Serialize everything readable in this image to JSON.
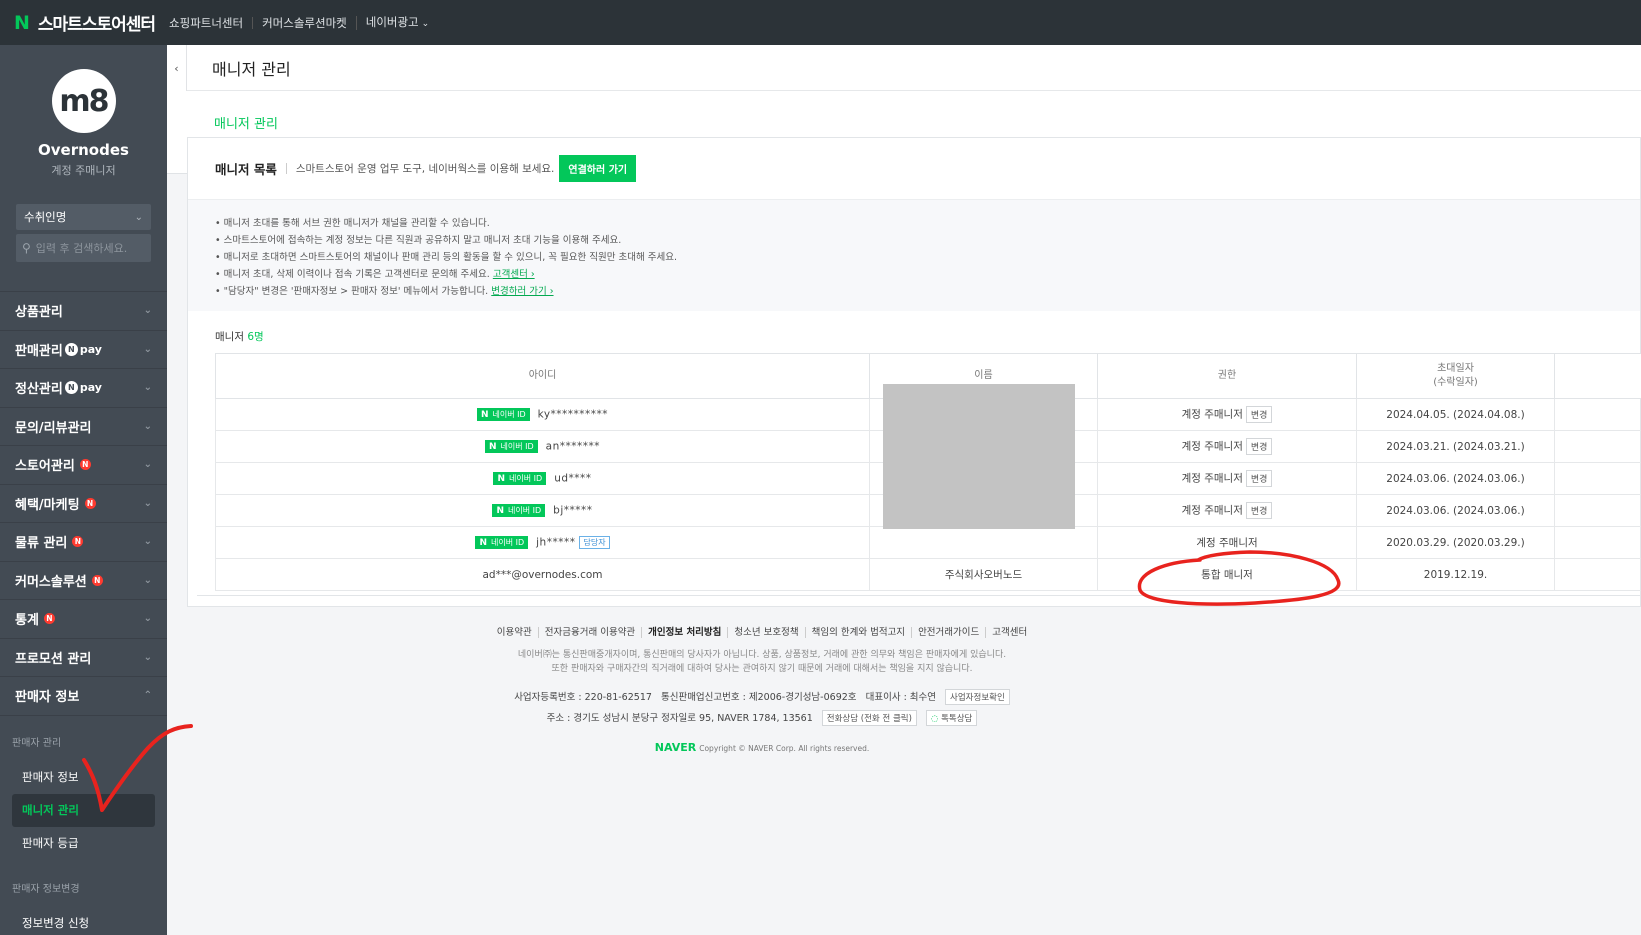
{
  "topbar": {
    "logo_letter": "N",
    "brand": "스마트스토어센터",
    "links": [
      "쇼핑파트너센터",
      "커머스솔루션마켓",
      "네이버광고"
    ]
  },
  "sidebar": {
    "avatar_text": "m8",
    "store_name": "Overnodes",
    "store_role": "계정 주매니저",
    "select_value": "수취인명",
    "search_placeholder": "입력 후 검색하세요.",
    "menu": [
      {
        "label": "상품관리"
      },
      {
        "label": "판매관리",
        "pay": "pay"
      },
      {
        "label": "정산관리",
        "pay": "pay"
      },
      {
        "label": "문의/리뷰관리"
      },
      {
        "label": "스토어관리",
        "badge": "N"
      },
      {
        "label": "혜택/마케팅",
        "badge": "N"
      },
      {
        "label": "물류 관리",
        "badge": "N"
      },
      {
        "label": "커머스솔루션",
        "badge": "N"
      },
      {
        "label": "통계",
        "badge": "N"
      },
      {
        "label": "프로모션 관리"
      },
      {
        "label": "판매자 정보"
      }
    ],
    "sub_head_1": "판매자 관리",
    "sub_items": [
      "판매자 정보",
      "매니저 관리",
      "판매자 등급"
    ],
    "sub_head_2": "판매자 정보변경",
    "sub_item_last": "정보변경 신청"
  },
  "page": {
    "title": "매니저 관리",
    "tab": "매니저 관리"
  },
  "card": {
    "title": "매니저 목록",
    "desc": "스마트스토어 운영 업무 도구, 네이버웍스를 이용해 보세요.",
    "connect_button": "연결하러 가기",
    "notices": [
      "• 매니저 초대를 통해 서브 권한 매니저가 채널을 관리할 수 있습니다.",
      "• 스마트스토어에 접속하는 계정 정보는 다른 직원과 공유하지 말고 매니저 초대 기능을 이용해 주세요.",
      "• 매니저로 초대하면 스마트스토어의 채널이나 판매 관리 등의 활동을 할 수 있으니, 꼭 필요한 직원만 초대해 주세요.",
      "• 매니저 초대, 삭제 이력이나 접속 기록은 고객센터로 문의해 주세요.",
      "• \"담당자\" 변경은 '판매자정보 > 판매자 정보' 메뉴에서 가능합니다."
    ],
    "notice_link_1": "고객센터 ›",
    "notice_link_2": "변경하러 가기 ›",
    "count_label": "매니저",
    "count_value": "6명"
  },
  "table": {
    "headers": [
      "아이디",
      "이름",
      "권한",
      "초대일자",
      "(수락일자)"
    ],
    "naver_id_label": "네이버 ID",
    "owner_tag": "담당자",
    "change_button": "변경",
    "rows": [
      {
        "id": "ky**********",
        "role": "계정 주매니저",
        "date": "2024.04.05. (2024.04.08.)"
      },
      {
        "id": "an*******",
        "role": "계정 주매니저",
        "date": "2024.03.21. (2024.03.21.)"
      },
      {
        "id": "ud****",
        "role": "계정 주매니저",
        "date": "2024.03.06. (2024.03.06.)"
      },
      {
        "id": "bj*****",
        "role": "계정 주매니저",
        "date": "2024.03.06. (2024.03.06.)"
      },
      {
        "id": "jh*****",
        "role": "계정 주매니저",
        "date": "2020.03.29. (2020.03.29.)"
      },
      {
        "id": "ad***@overnodes.com",
        "name": "주식회사오버노드",
        "role": "통합 매니저",
        "date": "2019.12.19."
      }
    ]
  },
  "footer": {
    "links": [
      "이용약관",
      "전자금융거래 이용약관",
      "개인정보 처리방침",
      "청소년 보호정책",
      "책임의 한계와 법적고지",
      "안전거래가이드",
      "고객센터"
    ],
    "disclaimer_1": "네이버㈜는 통신판매중개자이며, 통신판매의 당사자가 아닙니다. 상품, 상품정보, 거래에 관한 의무와 책임은 판매자에게 있습니다.",
    "disclaimer_2": "또한 판매자와 구매자간의 직거래에 대하여 당사는 관여하지 않기 때문에 거래에 대해서는 책임을 지지 않습니다.",
    "biz_no": "사업자등록번호 : 220-81-62517",
    "mail_order": "통신판매업신고번호 : 제2006-경기성남-0692호",
    "ceo": "대표이사 : 최수연",
    "biz_check": "사업자정보확인",
    "address": "주소 : 경기도 성남시 분당구 정자일로 95, NAVER 1784, 13561",
    "phone_btn": "전화상담 (전화 전 클릭)",
    "talk_btn": "톡톡상담",
    "naver_logo": "NAVER",
    "copyright": "Copyright © NAVER Corp. All rights reserved."
  },
  "colors": {
    "accent": "#03c75a",
    "sidebar_bg": "#434b54",
    "topbar_bg": "#2c3338",
    "annotation_red": "#e8231e"
  }
}
